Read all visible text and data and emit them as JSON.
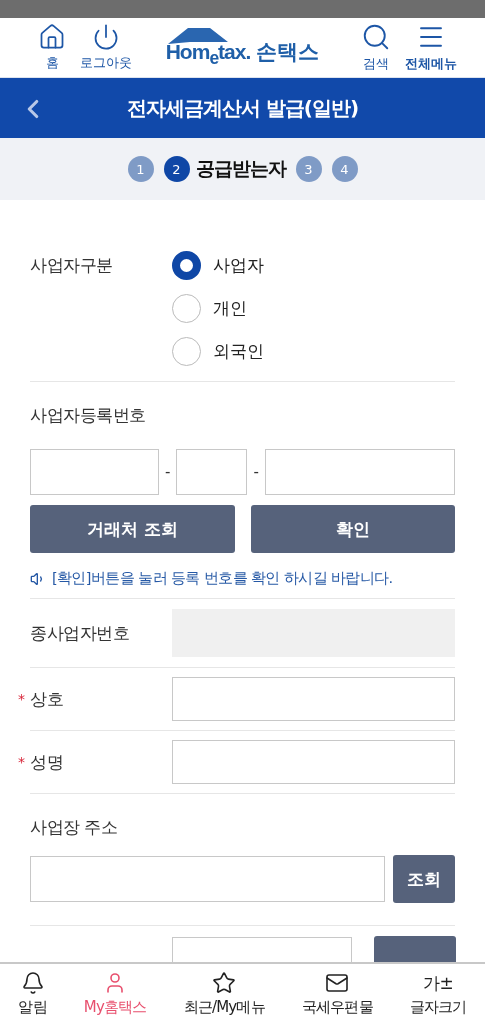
{
  "header": {
    "left_actions": [
      {
        "kind": "home",
        "label": "홈"
      },
      {
        "kind": "power",
        "label": "로그아웃"
      }
    ],
    "logo": {
      "brand": "Hom$_{e}$tax.",
      "app_name": "손택스"
    },
    "right_actions": [
      {
        "kind": "search",
        "label": "검색",
        "emphasized": false
      },
      {
        "kind": "menu",
        "label": "전체메뉴",
        "emphasized": true
      }
    ]
  },
  "title_bar": {
    "title": "전자세금계산서 발급(일반)"
  },
  "steps": [
    {
      "number": "1",
      "selected": false
    },
    {
      "number": "2",
      "selected": true,
      "label": "공급받는자"
    },
    {
      "number": "3",
      "selected": false
    },
    {
      "number": "4",
      "selected": false
    }
  ],
  "business_type": {
    "label": "사업자구분",
    "options": [
      {
        "label": "사업자",
        "selected": true
      },
      {
        "label": "개인",
        "selected": false
      },
      {
        "label": "외국인",
        "selected": false
      }
    ]
  },
  "registration": {
    "label": "사업자등록번호",
    "separators": [
      "-",
      "-"
    ],
    "buttons": [
      "거래처 조회",
      "확인"
    ],
    "notice": "[확인]버튼을 눌러 등록 번호를 확인 하시길 바랍니다."
  },
  "fields": [
    {
      "label": "종사업자번호",
      "disabled": true
    },
    {
      "label": "상호",
      "marker": "*",
      "disabled": false
    },
    {
      "label": "성명",
      "marker": "*",
      "disabled": false
    }
  ],
  "address": {
    "label": "사업장 주소",
    "button": "조회"
  },
  "bottom_nav": [
    {
      "kind": "bell",
      "label": "알림",
      "selected": false
    },
    {
      "kind": "person",
      "label": "My홈택스",
      "selected": true
    },
    {
      "kind": "star",
      "label": "최근/My메뉴",
      "selected": false
    },
    {
      "kind": "mail",
      "label": "국세우편물",
      "selected": false
    },
    {
      "kind": "text",
      "icon_text": "가±",
      "label": "글자크기",
      "selected": false
    }
  ]
}
